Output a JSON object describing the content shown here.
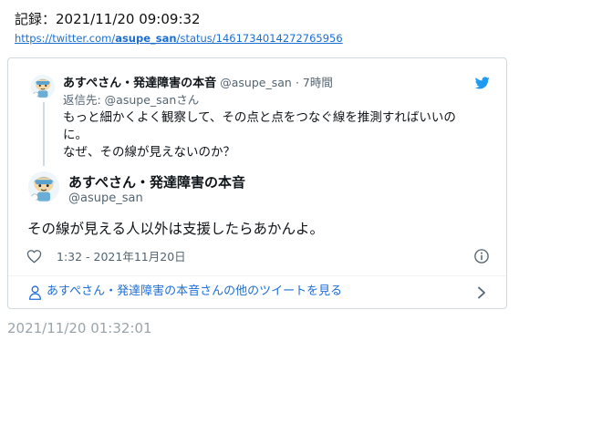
{
  "header": {
    "record_label": "記録：2021/11/20 09:09:32",
    "url_prefix": "https://twitter.com/",
    "url_user": "asupe_san",
    "url_suffix": "/status/1461734014272765956"
  },
  "quoted_tweet": {
    "display_name": "あすぺさん・発達障害の本音",
    "handle": "@asupe_san",
    "time_ago": "· 7時間",
    "reply_to": "返信先: @asupe_sanさん",
    "text_line1": "もっと細かくよく観察して、その点と点をつなぐ線を推測すればいいの",
    "text_line2": "に。",
    "text_line3": "なぜ、その線が見えないのか？"
  },
  "main_tweet": {
    "display_name": "あすぺさん・発達障害の本音",
    "handle": "@asupe_san",
    "text": "その線が見える人以外は支援したらあかんよ。",
    "timestamp": "1:32 - 2021年11月20日"
  },
  "footer": {
    "more_tweets_label": "あすぺさん・発達障害の本音さんの他のツイートを見る"
  },
  "archive_timestamp": "2021/11/20 01:32:01",
  "icons": {
    "heart": "heart-icon",
    "info": "info-icon",
    "person": "person-icon",
    "chevron": "chevron-right-icon",
    "bird": "twitter-bird-icon"
  },
  "colors": {
    "link": "#1b6fd1",
    "twitter_blue": "#1d9bf0",
    "secondary_text": "#536471",
    "border": "#cfd9de",
    "archive_gray": "#9aa4ab"
  }
}
